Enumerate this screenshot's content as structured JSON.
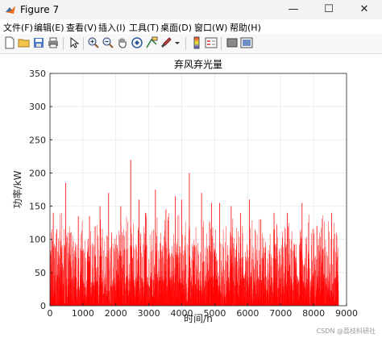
{
  "window": {
    "title": "Figure 7",
    "minimize_glyph": "—",
    "maximize_glyph": "☐",
    "close_glyph": "✕"
  },
  "menu": [
    {
      "label": "文件(F)"
    },
    {
      "label": "编辑(E)"
    },
    {
      "label": "查看(V)"
    },
    {
      "label": "插入(I)"
    },
    {
      "label": "工具(T)"
    },
    {
      "label": "桌面(D)"
    },
    {
      "label": "窗口(W)"
    },
    {
      "label": "帮助(H)"
    }
  ],
  "toolbar": {
    "icons": [
      "new-figure-icon",
      "open-file-icon",
      "save-icon",
      "print-icon",
      "select-arrow-icon",
      "zoom-in-icon",
      "zoom-out-icon",
      "pan-hand-icon",
      "rotate-3d-icon",
      "data-cursor-icon",
      "brush-icon",
      "dropdown-arrow-icon",
      "colorbar-icon",
      "legend-icon",
      "hide-plot-tools-icon",
      "show-plot-tools-icon"
    ]
  },
  "chart_data": {
    "type": "bar",
    "title": "弃风弃光量",
    "xlabel": "时间/h",
    "ylabel": "功率/kW",
    "xlim": [
      0,
      9000
    ],
    "ylim": [
      0,
      350
    ],
    "xticks": [
      0,
      1000,
      2000,
      3000,
      4000,
      5000,
      6000,
      7000,
      8000,
      9000
    ],
    "yticks": [
      0,
      50,
      100,
      150,
      200,
      250,
      300,
      350
    ],
    "grid": true,
    "color": "#ff0000",
    "series_length_hours": 8760,
    "peaks": [
      {
        "x": 100,
        "y": 140
      },
      {
        "x": 480,
        "y": 185
      },
      {
        "x": 860,
        "y": 135
      },
      {
        "x": 1200,
        "y": 135
      },
      {
        "x": 1520,
        "y": 150
      },
      {
        "x": 1780,
        "y": 170
      },
      {
        "x": 2150,
        "y": 150
      },
      {
        "x": 2450,
        "y": 220
      },
      {
        "x": 2700,
        "y": 160
      },
      {
        "x": 2900,
        "y": 140
      },
      {
        "x": 3200,
        "y": 175
      },
      {
        "x": 3520,
        "y": 145
      },
      {
        "x": 3800,
        "y": 165
      },
      {
        "x": 4000,
        "y": 160
      },
      {
        "x": 4230,
        "y": 200
      },
      {
        "x": 4600,
        "y": 170
      },
      {
        "x": 4900,
        "y": 155
      },
      {
        "x": 5150,
        "y": 155
      },
      {
        "x": 5500,
        "y": 150
      },
      {
        "x": 5780,
        "y": 140
      },
      {
        "x": 6050,
        "y": 160
      },
      {
        "x": 6400,
        "y": 130
      },
      {
        "x": 6800,
        "y": 140
      },
      {
        "x": 7200,
        "y": 140
      },
      {
        "x": 7650,
        "y": 155
      },
      {
        "x": 8100,
        "y": 120
      },
      {
        "x": 8550,
        "y": 140
      }
    ]
  },
  "footer": {
    "watermark": "CSDN @荔枝科研社"
  },
  "colors": {
    "accent": "#ff0000",
    "grid": "#e6e6e6",
    "axis": "#262626"
  }
}
